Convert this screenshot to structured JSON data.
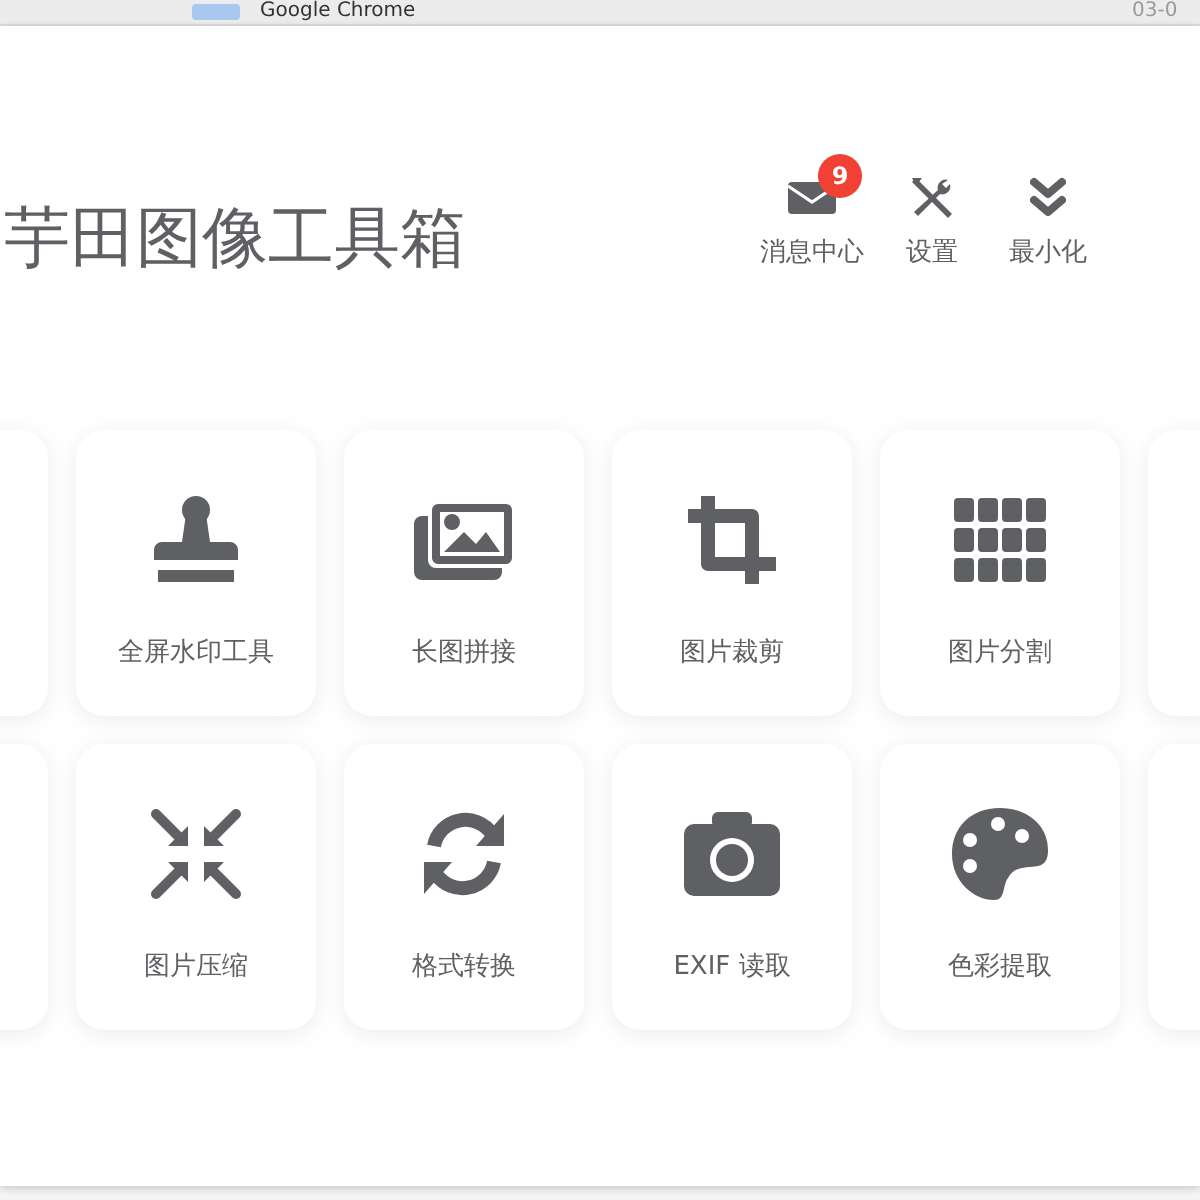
{
  "background_window": {
    "app_name": "Google Chrome",
    "date": "03-0"
  },
  "header": {
    "title": "芋田图像工具箱",
    "actions": [
      {
        "kind": "mail",
        "label": "消息中心",
        "badge": "9"
      },
      {
        "kind": "tools",
        "label": "设置"
      },
      {
        "kind": "chevrons",
        "label": "最小化"
      }
    ]
  },
  "tool_rows": [
    [
      {
        "kind": "stamp",
        "label": "全屏水印工具"
      },
      {
        "kind": "images",
        "label": "长图拼接"
      },
      {
        "kind": "crop",
        "label": "图片裁剪"
      },
      {
        "kind": "grid",
        "label": "图片分割"
      }
    ],
    [
      {
        "kind": "compress",
        "label": "图片压缩"
      },
      {
        "kind": "sync",
        "label": "格式转换"
      },
      {
        "kind": "camera",
        "label": "EXIF 读取"
      },
      {
        "kind": "palette",
        "label": "色彩提取"
      }
    ]
  ]
}
